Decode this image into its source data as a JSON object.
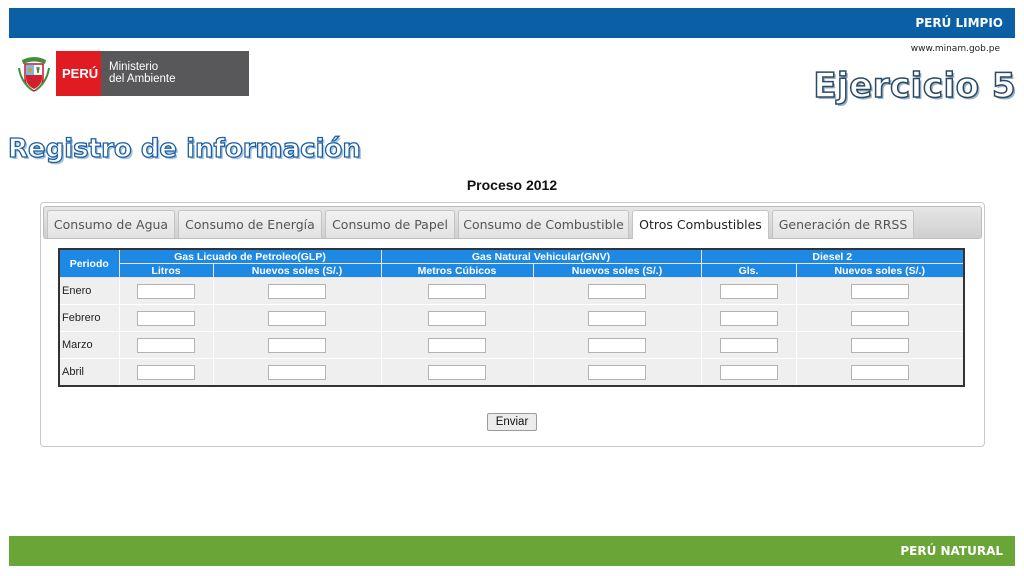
{
  "header": {
    "brand": "PERÚ LIMPIO",
    "url": "www.minam.gob.pe"
  },
  "footer": {
    "brand": "PERÚ NATURAL"
  },
  "logo": {
    "country": "PERÚ",
    "ministry_line1": "Ministerio",
    "ministry_line2": "del Ambiente",
    "shield_icon": "peru-coat-of-arms-icon"
  },
  "slide": {
    "exercise": "Ejercicio 5",
    "title": "Registro de información",
    "process": "Proceso 2012"
  },
  "tabs": [
    {
      "label": "Consumo de Agua"
    },
    {
      "label": "Consumo de Energía"
    },
    {
      "label": "Consumo de Papel"
    },
    {
      "label": "Consumo de Combustible"
    },
    {
      "label": "Otros Combustibles",
      "active": true
    },
    {
      "label": "Generación de RRSS"
    }
  ],
  "table": {
    "period_header": "Periodo",
    "groups": [
      "Gas Licuado de Petroleo(GLP)",
      "Gas Natural Vehicular(GNV)",
      "Diesel 2"
    ],
    "subheaders": [
      "Litros",
      "Nuevos soles (S/.)",
      "Metros Cúbicos",
      "Nuevos soles (S/.)",
      "Gls.",
      "Nuevos soles (S/.)"
    ],
    "rows": [
      {
        "period": "Enero",
        "values": [
          "",
          "",
          "",
          "",
          "",
          ""
        ]
      },
      {
        "period": "Febrero",
        "values": [
          "",
          "",
          "",
          "",
          "",
          ""
        ]
      },
      {
        "period": "Marzo",
        "values": [
          "",
          "",
          "",
          "",
          "",
          ""
        ]
      },
      {
        "period": "Abril",
        "values": [
          "",
          "",
          "",
          "",
          "",
          ""
        ]
      }
    ]
  },
  "submit_label": "Enviar",
  "colors": {
    "top_bar": "#0b5fa5",
    "bottom_bar": "#6aa637",
    "table_header": "#1e88e5",
    "peru_red": "#e11b22"
  }
}
